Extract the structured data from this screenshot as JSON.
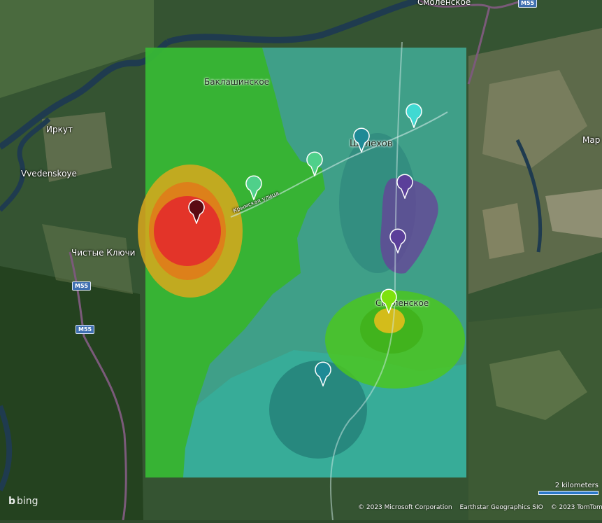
{
  "map": {
    "labels": {
      "irkut": "Иркут",
      "vvedenskoye": "Vvedenskoye",
      "chistye_klyuchi": "Чистые Ключи",
      "baklashinskoe": "Баклашинское",
      "shelekhov": "Шелехов",
      "smolenskoe_top": "Смоленское",
      "smolenskoe_south": "Смоленское",
      "street": "Крымская улица",
      "mar": "Мар"
    },
    "road_shields": [
      "M55",
      "M55",
      "M55"
    ],
    "markers": [
      {
        "name": "marker-dark-red",
        "color": "#5a0a12"
      },
      {
        "name": "marker-green-1",
        "color": "#4fd08a"
      },
      {
        "name": "marker-green-2",
        "color": "#4fd08a"
      },
      {
        "name": "marker-teal-1",
        "color": "#1e8a96"
      },
      {
        "name": "marker-cyan",
        "color": "#40d9d2"
      },
      {
        "name": "marker-purple-1",
        "color": "#5b3f9a"
      },
      {
        "name": "marker-purple-2",
        "color": "#5b3f9a"
      },
      {
        "name": "marker-lime",
        "color": "#7ee20e"
      },
      {
        "name": "marker-teal-2",
        "color": "#1e8a96"
      }
    ]
  },
  "logo": {
    "text": "bing"
  },
  "attribution": {
    "microsoft": "© 2023 Microsoft Corporation",
    "earthstar": "Earthstar Geographics  SIO",
    "tomtom": "© 2023 TomTom"
  },
  "scale": {
    "label": "2 kilometers"
  }
}
